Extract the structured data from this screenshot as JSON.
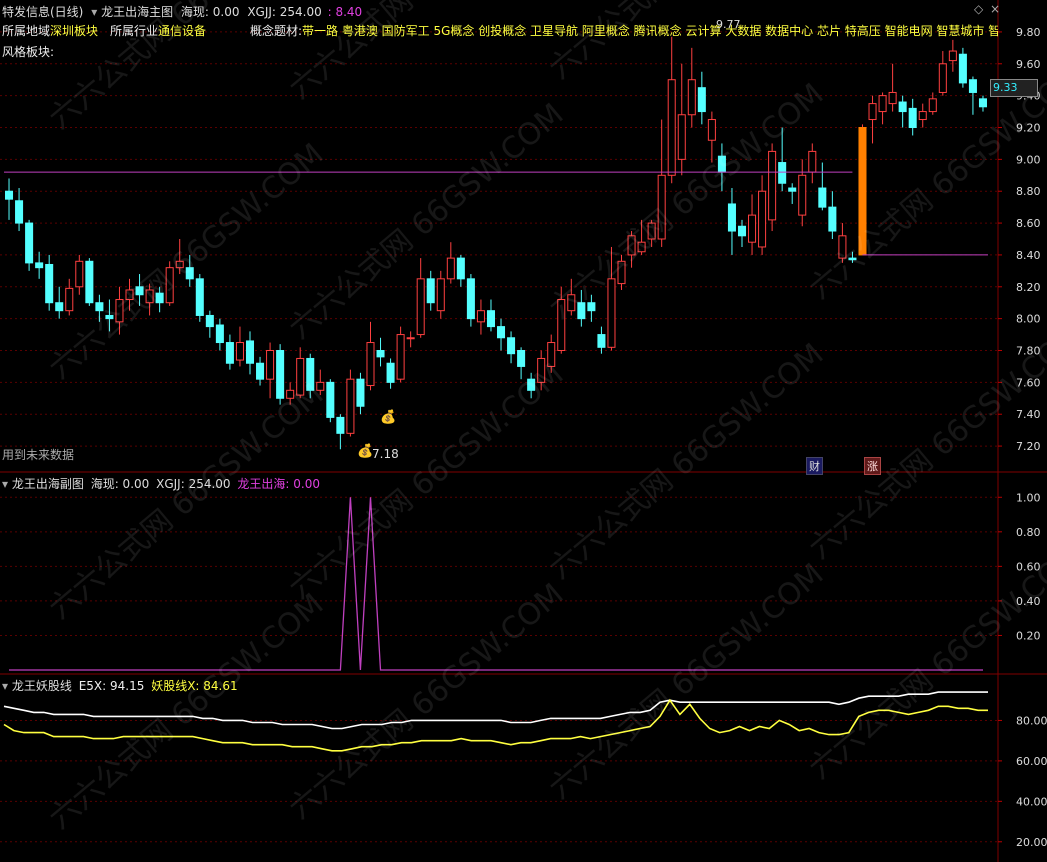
{
  "header": {
    "stock_name": "特发信息(日线)",
    "main_indicator": "龙王出海主图",
    "main_hai_label": "海现: 0.00",
    "main_xgjj_label": "XGJJ: 254.00",
    "main_value": "8.40"
  },
  "info": {
    "region_label": "所属地域",
    "region_value": "深圳板块",
    "industry_label": "所属行业",
    "industry_value": "通信设备",
    "concept_label": "概念题材:",
    "concepts": "带一路 粤港澳 国防军工 5G概念 创投概念 卫星导航 阿里概念 腾讯概念 云计算 大数据 数据中心 芯片 特高压 智能电网 智慧城市 智慧",
    "style_label": "风格板块:",
    "future_data_note": "用到未来数据"
  },
  "annotations": {
    "low_price": "7.18",
    "high_price_partial": "9.77",
    "last_price": "9.33",
    "finance_badge": "财",
    "limit_badge": "涨"
  },
  "sub1": {
    "name": "龙王出海副图",
    "hai_label": "海现: 0.00",
    "xgjj_label": "XGJJ: 254.00",
    "series_label": "龙王出海: 0.00"
  },
  "sub2": {
    "name": "龙王妖股线",
    "e5x_label": "E5X: 94.15",
    "yao_label": "妖股线X: 84.61"
  },
  "watermark": "六六公式网 66GSW.COM",
  "colors": {
    "up": "#ff4040",
    "down": "#54ffff",
    "hline": "#c040c0",
    "e5x": "#ffffff",
    "yao": "#ffff40",
    "accent_bar": "#ff8000"
  },
  "chart_data": [
    {
      "type": "candlestick",
      "title": "龙王出海主图",
      "ylim": [
        7.1,
        9.9
      ],
      "yticks": [
        "9.80",
        "9.60",
        "9.40",
        "9.20",
        "9.00",
        "8.80",
        "8.60",
        "8.40",
        "8.20",
        "8.00",
        "7.80",
        "7.60",
        "7.40",
        "7.20"
      ],
      "hlines": [
        8.92,
        8.4
      ],
      "ohlc": [
        [
          8.8,
          8.75,
          8.88,
          8.62
        ],
        [
          8.74,
          8.6,
          8.82,
          8.55
        ],
        [
          8.6,
          8.35,
          8.62,
          8.3
        ],
        [
          8.35,
          8.32,
          8.42,
          8.25
        ],
        [
          8.34,
          8.1,
          8.4,
          8.05
        ],
        [
          8.1,
          8.05,
          8.2,
          8.0
        ],
        [
          8.05,
          8.19,
          8.25,
          8.02
        ],
        [
          8.2,
          8.36,
          8.4,
          8.15
        ],
        [
          8.36,
          8.1,
          8.38,
          8.08
        ],
        [
          8.1,
          8.05,
          8.15,
          7.98
        ],
        [
          8.02,
          8.0,
          8.12,
          7.92
        ],
        [
          7.98,
          8.12,
          8.2,
          7.9
        ],
        [
          8.12,
          8.18,
          8.25,
          8.05
        ],
        [
          8.2,
          8.15,
          8.28,
          8.08
        ],
        [
          8.1,
          8.18,
          8.22,
          8.02
        ],
        [
          8.16,
          8.1,
          8.2,
          8.04
        ],
        [
          8.1,
          8.32,
          8.36,
          8.08
        ],
        [
          8.32,
          8.36,
          8.5,
          8.28
        ],
        [
          8.32,
          8.25,
          8.4,
          8.2
        ],
        [
          8.25,
          8.02,
          8.28,
          7.98
        ],
        [
          8.02,
          7.95,
          8.05,
          7.88
        ],
        [
          7.96,
          7.85,
          8.0,
          7.8
        ],
        [
          7.85,
          7.72,
          7.9,
          7.68
        ],
        [
          7.74,
          7.85,
          7.95,
          7.7
        ],
        [
          7.86,
          7.72,
          7.92,
          7.65
        ],
        [
          7.72,
          7.62,
          7.76,
          7.58
        ],
        [
          7.62,
          7.8,
          7.85,
          7.5
        ],
        [
          7.8,
          7.5,
          7.84,
          7.46
        ],
        [
          7.5,
          7.55,
          7.6,
          7.46
        ],
        [
          7.52,
          7.75,
          7.82,
          7.5
        ],
        [
          7.75,
          7.55,
          7.78,
          7.5
        ],
        [
          7.55,
          7.6,
          7.68,
          7.52
        ],
        [
          7.6,
          7.38,
          7.62,
          7.35
        ],
        [
          7.38,
          7.28,
          7.4,
          7.18
        ],
        [
          7.28,
          7.62,
          7.68,
          7.26
        ],
        [
          7.62,
          7.45,
          7.66,
          7.4
        ],
        [
          7.58,
          7.85,
          7.98,
          7.55
        ],
        [
          7.8,
          7.76,
          7.88,
          7.7
        ],
        [
          7.72,
          7.6,
          7.75,
          7.56
        ],
        [
          7.62,
          7.9,
          7.95,
          7.6
        ],
        [
          7.88,
          7.88,
          7.92,
          7.82
        ],
        [
          7.9,
          8.25,
          8.38,
          7.88
        ],
        [
          8.25,
          8.1,
          8.3,
          8.05
        ],
        [
          8.05,
          8.25,
          8.3,
          8.0
        ],
        [
          8.25,
          8.38,
          8.48,
          8.22
        ],
        [
          8.38,
          8.25,
          8.4,
          8.2
        ],
        [
          8.25,
          8.0,
          8.28,
          7.95
        ],
        [
          7.98,
          8.05,
          8.12,
          7.9
        ],
        [
          8.05,
          7.95,
          8.12,
          7.92
        ],
        [
          7.95,
          7.88,
          8.0,
          7.8
        ],
        [
          7.88,
          7.78,
          7.92,
          7.72
        ],
        [
          7.8,
          7.7,
          7.82,
          7.62
        ],
        [
          7.62,
          7.55,
          7.66,
          7.5
        ],
        [
          7.6,
          7.75,
          7.8,
          7.55
        ],
        [
          7.7,
          7.85,
          7.9,
          7.66
        ],
        [
          7.8,
          8.12,
          8.2,
          7.78
        ],
        [
          8.05,
          8.15,
          8.25,
          8.02
        ],
        [
          8.1,
          8.0,
          8.18,
          7.95
        ],
        [
          8.1,
          8.05,
          8.15,
          7.98
        ],
        [
          7.9,
          7.82,
          7.95,
          7.78
        ],
        [
          7.82,
          8.25,
          8.45,
          7.8
        ],
        [
          8.22,
          8.36,
          8.4,
          8.18
        ],
        [
          8.4,
          8.52,
          8.55,
          8.32
        ],
        [
          8.42,
          8.48,
          8.62,
          8.4
        ],
        [
          8.5,
          8.6,
          8.62,
          8.45
        ],
        [
          8.5,
          8.9,
          9.25,
          8.45
        ],
        [
          8.9,
          9.5,
          9.77,
          8.85
        ],
        [
          9.0,
          9.28,
          9.6,
          8.9
        ],
        [
          9.28,
          9.5,
          9.7,
          9.2
        ],
        [
          9.45,
          9.3,
          9.55,
          9.22
        ],
        [
          9.12,
          9.25,
          9.3,
          8.98
        ],
        [
          9.02,
          8.92,
          9.1,
          8.8
        ],
        [
          8.72,
          8.55,
          8.82,
          8.4
        ],
        [
          8.58,
          8.52,
          8.62,
          8.45
        ],
        [
          8.48,
          8.65,
          8.78,
          8.4
        ],
        [
          8.45,
          8.8,
          8.9,
          8.4
        ],
        [
          8.62,
          9.05,
          9.1,
          8.55
        ],
        [
          8.98,
          8.85,
          9.2,
          8.8
        ],
        [
          8.82,
          8.8,
          8.85,
          8.72
        ],
        [
          8.65,
          8.9,
          9.0,
          8.58
        ],
        [
          8.92,
          9.05,
          9.1,
          8.85
        ],
        [
          8.82,
          8.7,
          8.98,
          8.68
        ],
        [
          8.7,
          8.55,
          8.8,
          8.5
        ],
        [
          8.38,
          8.52,
          8.6,
          8.35
        ],
        [
          8.38,
          8.37,
          8.42,
          8.35
        ],
        [
          8.4,
          9.2,
          9.22,
          8.4
        ],
        [
          9.25,
          9.35,
          9.4,
          9.1
        ],
        [
          9.3,
          9.4,
          9.42,
          9.22
        ],
        [
          9.35,
          9.42,
          9.6,
          9.3
        ],
        [
          9.36,
          9.3,
          9.4,
          9.2
        ],
        [
          9.32,
          9.2,
          9.38,
          9.15
        ],
        [
          9.25,
          9.3,
          9.35,
          9.2
        ],
        [
          9.3,
          9.38,
          9.42,
          9.28
        ],
        [
          9.42,
          9.6,
          9.68,
          9.4
        ],
        [
          9.62,
          9.68,
          9.75,
          9.55
        ],
        [
          9.66,
          9.48,
          9.7,
          9.45
        ],
        [
          9.5,
          9.42,
          9.52,
          9.28
        ],
        [
          9.38,
          9.33,
          9.4,
          9.3
        ]
      ]
    },
    {
      "type": "line",
      "title": "龙王出海副图",
      "ylim": [
        0,
        1.1
      ],
      "yticks": [
        "1.00",
        "0.80",
        "0.60",
        "0.40",
        "0.20"
      ],
      "series": [
        {
          "name": "龙王出海",
          "values": [
            0,
            0,
            0,
            0,
            0,
            0,
            0,
            0,
            0,
            0,
            0,
            0,
            0,
            0,
            0,
            0,
            0,
            0,
            0,
            0,
            0,
            0,
            0,
            0,
            0,
            0,
            0,
            0,
            0,
            0,
            0,
            0,
            0,
            0,
            1,
            0,
            1,
            0,
            0,
            0,
            0,
            0,
            0,
            0,
            0,
            0,
            0,
            0,
            0,
            0,
            0,
            0,
            0,
            0,
            0,
            0,
            0,
            0,
            0,
            0,
            0,
            0,
            0,
            0,
            0,
            0,
            0,
            0,
            0,
            0,
            0,
            0,
            0,
            0,
            0,
            0,
            0,
            0,
            0,
            0,
            0,
            0,
            0,
            0,
            0,
            0,
            0,
            0,
            0,
            0,
            0,
            0,
            0,
            0,
            0,
            0,
            0,
            0
          ]
        }
      ]
    },
    {
      "type": "line",
      "title": "龙王妖股线",
      "ylim": [
        10,
        100
      ],
      "yticks": [
        "80.00",
        "60.00",
        "40.00",
        "20.00"
      ],
      "series": [
        {
          "name": "E5X",
          "values": [
            87,
            86,
            85,
            84,
            84,
            83,
            83,
            83,
            83,
            82,
            82,
            82,
            82,
            82,
            82,
            82,
            82,
            82,
            82,
            82,
            81,
            81,
            80,
            80,
            80,
            79,
            79,
            79,
            78,
            78,
            78,
            78,
            77,
            76,
            76,
            77,
            78,
            78,
            78,
            79,
            79,
            80,
            80,
            80,
            80,
            80,
            80,
            80,
            80,
            80,
            80,
            79,
            79,
            79,
            80,
            81,
            81,
            81,
            81,
            81,
            81,
            82,
            83,
            84,
            84,
            85,
            89,
            90,
            89,
            89,
            89,
            89,
            89,
            89,
            89,
            89,
            89,
            89,
            89,
            89,
            89,
            89,
            89,
            89,
            88,
            89,
            91,
            92,
            92,
            92,
            92,
            93,
            93,
            93,
            94,
            94,
            94,
            94,
            94,
            94
          ]
        },
        {
          "name": "妖股线X",
          "values": [
            78,
            75,
            74,
            74,
            74,
            72,
            72,
            72,
            72,
            71,
            71,
            71,
            72,
            72,
            72,
            72,
            72,
            72,
            72,
            72,
            71,
            70,
            69,
            69,
            69,
            68,
            68,
            68,
            68,
            67,
            67,
            67,
            66,
            65,
            65,
            66,
            67,
            67,
            68,
            68,
            69,
            69,
            70,
            70,
            70,
            70,
            71,
            70,
            70,
            70,
            69,
            68,
            69,
            69,
            70,
            71,
            71,
            71,
            72,
            71,
            72,
            73,
            74,
            75,
            76,
            77,
            82,
            90,
            83,
            88,
            81,
            76,
            74,
            75,
            77,
            75,
            77,
            76,
            80,
            78,
            75,
            76,
            74,
            73,
            73,
            74,
            82,
            84,
            85,
            85,
            84,
            83,
            84,
            85,
            87,
            87,
            86,
            86,
            85,
            85
          ]
        }
      ]
    }
  ]
}
